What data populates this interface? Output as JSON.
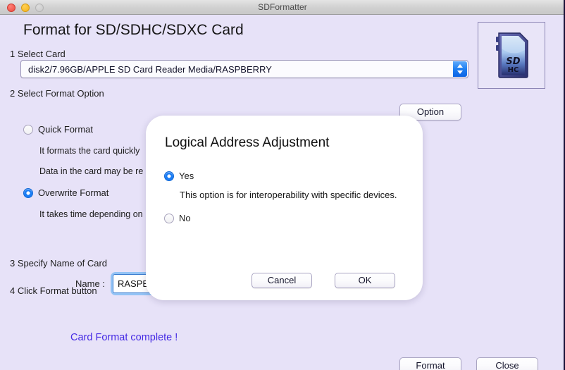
{
  "window": {
    "title": "SDFormatter",
    "controls": {
      "close": "close-button",
      "minimize": "minimize-button",
      "zoom": "zoom-button"
    }
  },
  "page": {
    "title": "Format for SD/SDHC/SDXC Card",
    "card_art_top_text": "SD",
    "card_art_bottom_text": "HC"
  },
  "steps": {
    "step1": "1 Select Card",
    "step2": "2 Select Format Option",
    "step3": "3 Specify Name of Card",
    "step4": "4 Click Format button"
  },
  "card_select": {
    "value": "disk2/7.96GB/APPLE SD Card Reader Media/RASPBERRY",
    "options": [
      "disk2/7.96GB/APPLE SD Card Reader Media/RASPBERRY"
    ]
  },
  "format_options": {
    "option_button_label": "Option",
    "quick": {
      "label": "Quick Format",
      "selected": false,
      "desc1": "It formats the card quickly",
      "desc2": "Data in the card may be re"
    },
    "overwrite": {
      "label": "Overwrite Format",
      "selected": true,
      "desc1": "It takes time depending on"
    }
  },
  "name_field": {
    "label": "Name :",
    "value": "RASPE",
    "placeholder": ""
  },
  "status": {
    "message": "Card Format complete !",
    "color": "#4429e4"
  },
  "bottom_buttons": {
    "format": "Format",
    "close": "Close"
  },
  "modal": {
    "title": "Logical Address Adjustment",
    "yes": {
      "label": "Yes",
      "selected": true,
      "description": "This option is for interoperability with specific devices."
    },
    "no": {
      "label": "No",
      "selected": false
    },
    "cancel_label": "Cancel",
    "ok_label": "OK"
  },
  "colors": {
    "window_background": "#e7e2f8",
    "accent_blue": "#1b7df5",
    "status_text": "#4429e4",
    "modal_background": "#ffffff"
  }
}
